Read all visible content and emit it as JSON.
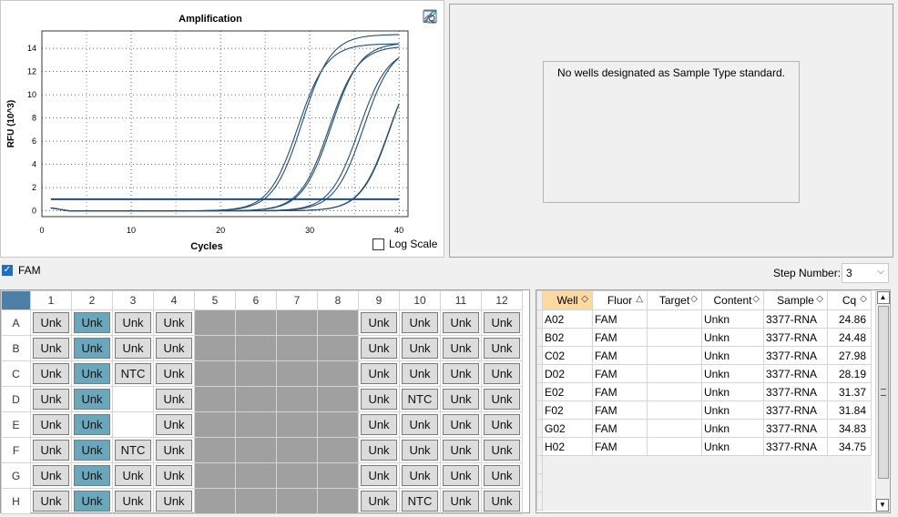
{
  "chart_data": {
    "type": "line",
    "title": "Amplification",
    "xlabel": "Cycles",
    "ylabel": "RFU (10^3)",
    "xlim": [
      0,
      41
    ],
    "ylim": [
      -0.5,
      15.5
    ],
    "xticks": [
      0,
      10,
      20,
      30,
      40
    ],
    "yticks": [
      0,
      2,
      4,
      6,
      8,
      10,
      12,
      14
    ],
    "threshold": 1.0,
    "grid": true,
    "series": [
      {
        "cq": 24.86,
        "plateau": 15.2
      },
      {
        "cq": 24.48,
        "plateau": 14.4
      },
      {
        "cq": 27.98,
        "plateau": 14.2
      },
      {
        "cq": 28.19,
        "plateau": 14.5
      },
      {
        "cq": 31.37,
        "plateau": 14.0
      },
      {
        "cq": 31.84,
        "plateau": 14.3
      },
      {
        "cq": 34.83,
        "plateau": 14.1
      },
      {
        "cq": 34.75,
        "plateau": 13.8
      }
    ],
    "line_color": "#1f4e79"
  },
  "chart": {
    "log_scale_label": "Log Scale"
  },
  "tool_icons": [
    "copy-icon",
    "chart-settings-icon",
    "export-icon",
    "zoom-icon",
    "curve-icon"
  ],
  "standard_panel": {
    "message": "No wells designated as Sample Type standard."
  },
  "fluor_filter": {
    "label": "FAM",
    "checked": true
  },
  "step": {
    "label": "Step Number:",
    "value": "3"
  },
  "plate": {
    "columns": [
      "1",
      "2",
      "3",
      "4",
      "5",
      "6",
      "7",
      "8",
      "9",
      "10",
      "11",
      "12"
    ],
    "rows": [
      {
        "label": "A",
        "wells": [
          "Unk",
          "Unk",
          "Unk",
          "Unk",
          "",
          "",
          "",
          "",
          "Unk",
          "Unk",
          "Unk",
          "Unk"
        ]
      },
      {
        "label": "B",
        "wells": [
          "Unk",
          "Unk",
          "Unk",
          "Unk",
          "",
          "",
          "",
          "",
          "Unk",
          "Unk",
          "Unk",
          "Unk"
        ]
      },
      {
        "label": "C",
        "wells": [
          "Unk",
          "Unk",
          "NTC",
          "Unk",
          "",
          "",
          "",
          "",
          "Unk",
          "Unk",
          "Unk",
          "Unk"
        ]
      },
      {
        "label": "D",
        "wells": [
          "Unk",
          "Unk",
          "",
          "Unk",
          "",
          "",
          "",
          "",
          "Unk",
          "NTC",
          "Unk",
          "Unk"
        ]
      },
      {
        "label": "E",
        "wells": [
          "Unk",
          "Unk",
          "",
          "Unk",
          "",
          "",
          "",
          "",
          "Unk",
          "Unk",
          "Unk",
          "Unk"
        ]
      },
      {
        "label": "F",
        "wells": [
          "Unk",
          "Unk",
          "NTC",
          "Unk",
          "",
          "",
          "",
          "",
          "Unk",
          "Unk",
          "Unk",
          "Unk"
        ]
      },
      {
        "label": "G",
        "wells": [
          "Unk",
          "Unk",
          "Unk",
          "Unk",
          "",
          "",
          "",
          "",
          "Unk",
          "Unk",
          "Unk",
          "Unk"
        ]
      },
      {
        "label": "H",
        "wells": [
          "Unk",
          "Unk",
          "Unk",
          "Unk",
          "",
          "",
          "",
          "",
          "Unk",
          "NTC",
          "Unk",
          "Unk"
        ]
      }
    ],
    "selected_column": 2
  },
  "well_table": {
    "headers": [
      "Well",
      "Fluor",
      "Target",
      "Content",
      "Sample",
      "Cq"
    ],
    "rows": [
      {
        "well": "A02",
        "fluor": "FAM",
        "target": "",
        "content": "Unkn",
        "sample": "3377-RNA",
        "cq": "24.86"
      },
      {
        "well": "B02",
        "fluor": "FAM",
        "target": "",
        "content": "Unkn",
        "sample": "3377-RNA",
        "cq": "24.48"
      },
      {
        "well": "C02",
        "fluor": "FAM",
        "target": "",
        "content": "Unkn",
        "sample": "3377-RNA",
        "cq": "27.98"
      },
      {
        "well": "D02",
        "fluor": "FAM",
        "target": "",
        "content": "Unkn",
        "sample": "3377-RNA",
        "cq": "28.19"
      },
      {
        "well": "E02",
        "fluor": "FAM",
        "target": "",
        "content": "Unkn",
        "sample": "3377-RNA",
        "cq": "31.37"
      },
      {
        "well": "F02",
        "fluor": "FAM",
        "target": "",
        "content": "Unkn",
        "sample": "3377-RNA",
        "cq": "31.84"
      },
      {
        "well": "G02",
        "fluor": "FAM",
        "target": "",
        "content": "Unkn",
        "sample": "3377-RNA",
        "cq": "34.83"
      },
      {
        "well": "H02",
        "fluor": "FAM",
        "target": "",
        "content": "Unkn",
        "sample": "3377-RNA",
        "cq": "34.75"
      }
    ]
  }
}
